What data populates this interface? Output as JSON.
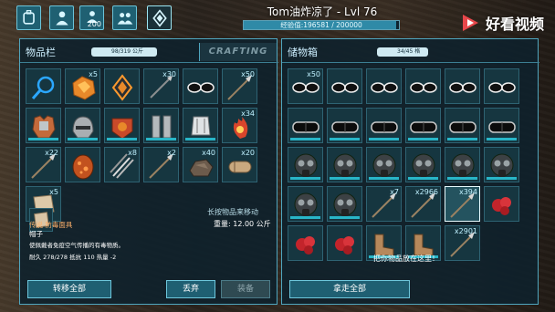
{
  "player": {
    "name_level": "Tom油炸凉了 - Lvl 76",
    "xp_text": "经验值:196581 / 200000",
    "xp_fraction": 0.983
  },
  "topbar": {
    "buttons": [
      {
        "name": "inventory-tab-button",
        "icon": "backpack-icon",
        "count": ""
      },
      {
        "name": "character-tab-button",
        "icon": "player-silhouette-icon",
        "count": ""
      },
      {
        "name": "engrams-tab-button",
        "icon": "engram-silhouette-icon",
        "count": "200"
      },
      {
        "name": "tribe-tab-button",
        "icon": "tribe-icon",
        "count": ""
      },
      {
        "name": "implant-tab-button",
        "icon": "crystal-emblem-icon",
        "count": ""
      }
    ]
  },
  "watermark": {
    "text": "好看视频"
  },
  "left_panel": {
    "title": "物品栏",
    "weight_pill": "98/319 公斤",
    "crafting_tab": "CRAFTING",
    "items": [
      {
        "icon": "magnifying-glass-icon",
        "qty": "",
        "dur": false,
        "selected": false
      },
      {
        "icon": "amber-chunk-icon",
        "qty": "x5",
        "dur": false,
        "selected": false
      },
      {
        "icon": "amber-gem-icon",
        "qty": "",
        "dur": false,
        "selected": false
      },
      {
        "icon": "arrow-icon",
        "qty": "x30",
        "dur": false,
        "selected": false
      },
      {
        "icon": "glasses-icon",
        "qty": "",
        "dur": false,
        "selected": false
      },
      {
        "icon": "spear-icon",
        "qty": "x50",
        "dur": false,
        "selected": false
      },
      {
        "icon": "chest-armor-icon",
        "qty": "",
        "dur": true,
        "selected": false
      },
      {
        "icon": "helmet-icon",
        "qty": "",
        "dur": true,
        "selected": false
      },
      {
        "icon": "riot-armor-icon",
        "qty": "",
        "dur": true,
        "selected": false
      },
      {
        "icon": "leg-armor-icon",
        "qty": "",
        "dur": true,
        "selected": false
      },
      {
        "icon": "gauntlet-icon",
        "qty": "",
        "dur": true,
        "selected": false
      },
      {
        "icon": "flame-plant-icon",
        "qty": "x34",
        "dur": false,
        "selected": false
      },
      {
        "icon": "spear-icon",
        "qty": "x22",
        "dur": false,
        "selected": false
      },
      {
        "icon": "egg-icon",
        "qty": "",
        "dur": false,
        "selected": false
      },
      {
        "icon": "arrow-bundle-icon",
        "qty": "x8",
        "dur": false,
        "selected": false
      },
      {
        "icon": "spear-icon",
        "qty": "x2",
        "dur": false,
        "selected": false
      },
      {
        "icon": "rock-icon",
        "qty": "x40",
        "dur": false,
        "selected": false
      },
      {
        "icon": "hide-roll-icon",
        "qty": "x20",
        "dur": false,
        "selected": false
      },
      {
        "icon": "leather-icon",
        "qty": "x5",
        "dur": false,
        "selected": false
      }
    ],
    "hint": "长按物品来移动",
    "weight_text": "重量: 12.00 公斤",
    "item_name": "传说 防毒面具",
    "item_sub": "帽子",
    "item_desc": "使佩戴者免疫空气传播的有毒物质。",
    "item_stats": "耐久 278/278   抵抗 110   热量 -2",
    "buttons": {
      "transfer_all": "转移全部",
      "drop": "丢弃",
      "equip": "装备"
    }
  },
  "right_panel": {
    "title": "储物箱",
    "weight_pill": "34/45 格",
    "items": [
      {
        "icon": "glasses-icon",
        "qty": "x50",
        "dur": false,
        "selected": false
      },
      {
        "icon": "glasses-icon",
        "qty": "",
        "dur": false,
        "selected": false
      },
      {
        "icon": "glasses-icon",
        "qty": "",
        "dur": false,
        "selected": false
      },
      {
        "icon": "glasses-icon",
        "qty": "",
        "dur": false,
        "selected": false
      },
      {
        "icon": "glasses-icon",
        "qty": "",
        "dur": false,
        "selected": false
      },
      {
        "icon": "glasses-icon",
        "qty": "",
        "dur": false,
        "selected": false
      },
      {
        "icon": "goggles-icon",
        "qty": "",
        "dur": true,
        "selected": false
      },
      {
        "icon": "goggles-icon",
        "qty": "",
        "dur": true,
        "selected": false
      },
      {
        "icon": "goggles-icon",
        "qty": "",
        "dur": true,
        "selected": false
      },
      {
        "icon": "goggles-icon",
        "qty": "",
        "dur": true,
        "selected": false
      },
      {
        "icon": "goggles-icon",
        "qty": "",
        "dur": true,
        "selected": false
      },
      {
        "icon": "goggles-icon",
        "qty": "",
        "dur": true,
        "selected": false
      },
      {
        "icon": "gas-mask-icon",
        "qty": "",
        "dur": true,
        "selected": false
      },
      {
        "icon": "gas-mask-icon",
        "qty": "",
        "dur": true,
        "selected": false
      },
      {
        "icon": "gas-mask-icon",
        "qty": "",
        "dur": true,
        "selected": false
      },
      {
        "icon": "gas-mask-icon",
        "qty": "",
        "dur": true,
        "selected": false
      },
      {
        "icon": "gas-mask-icon",
        "qty": "",
        "dur": true,
        "selected": false
      },
      {
        "icon": "gas-mask-icon",
        "qty": "",
        "dur": true,
        "selected": false
      },
      {
        "icon": "gas-mask-icon",
        "qty": "",
        "dur": true,
        "selected": false
      },
      {
        "icon": "gas-mask-icon",
        "qty": "",
        "dur": true,
        "selected": false
      },
      {
        "icon": "spear-icon",
        "qty": "x7",
        "dur": false,
        "selected": false
      },
      {
        "icon": "spear-icon",
        "qty": "x2966",
        "dur": false,
        "selected": false
      },
      {
        "icon": "spear-icon",
        "qty": "x394",
        "dur": false,
        "selected": true
      },
      {
        "icon": "red-berry-icon",
        "qty": "",
        "dur": false,
        "selected": false
      },
      {
        "icon": "red-berry-icon",
        "qty": "",
        "dur": false,
        "selected": false
      },
      {
        "icon": "red-berry-icon",
        "qty": "",
        "dur": false,
        "selected": false
      },
      {
        "icon": "leather-boots-icon",
        "qty": "",
        "dur": true,
        "selected": false
      },
      {
        "icon": "leather-boots-icon",
        "qty": "",
        "dur": true,
        "selected": false
      },
      {
        "icon": "spear-icon",
        "qty": "x2901",
        "dur": false,
        "selected": false
      }
    ],
    "hint": "把你物品放在这里！",
    "buttons": {
      "take_all": "拿走全部"
    }
  },
  "colors": {
    "panel": "#0e212c",
    "accent": "#4fa6bf",
    "durability": "#28b6c8",
    "legendary": "#ffb26c"
  }
}
